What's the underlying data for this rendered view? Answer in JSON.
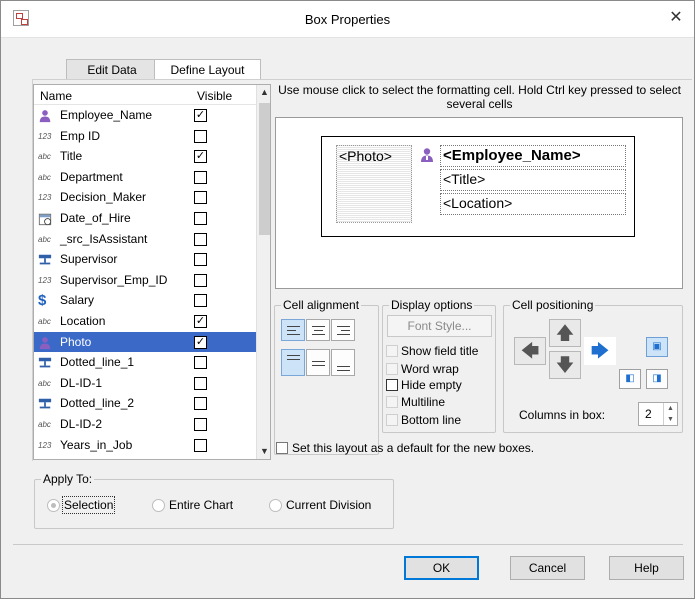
{
  "window": {
    "title": "Box Properties",
    "close_glyph": "✕"
  },
  "tabs": [
    {
      "label": "Edit Data",
      "active": false
    },
    {
      "label": "Define Layout",
      "active": true
    }
  ],
  "field_list": {
    "header_name": "Name",
    "header_visible": "Visible",
    "rows": [
      {
        "name": "Employee_Name",
        "icon": "person-icon",
        "visible": true,
        "selected": false
      },
      {
        "name": "Emp ID",
        "icon": "number-type-icon",
        "visible": false,
        "selected": false
      },
      {
        "name": "Title",
        "icon": "text-type-icon",
        "visible": true,
        "selected": false
      },
      {
        "name": "Department",
        "icon": "text-type-icon",
        "visible": false,
        "selected": false
      },
      {
        "name": "Decision_Maker",
        "icon": "number-type-icon",
        "visible": false,
        "selected": false
      },
      {
        "name": "Date_of_Hire",
        "icon": "calendar-icon",
        "visible": false,
        "selected": false
      },
      {
        "name": "_src_IsAssistant",
        "icon": "text-type-icon",
        "visible": false,
        "selected": false
      },
      {
        "name": "Supervisor",
        "icon": "org-link-icon",
        "visible": false,
        "selected": false
      },
      {
        "name": "Supervisor_Emp_ID",
        "icon": "number-type-icon",
        "visible": false,
        "selected": false
      },
      {
        "name": "Salary",
        "icon": "dollar-icon",
        "visible": false,
        "selected": false
      },
      {
        "name": "Location",
        "icon": "text-type-icon",
        "visible": true,
        "selected": false
      },
      {
        "name": "Photo",
        "icon": "photo-person-icon",
        "visible": true,
        "selected": true
      },
      {
        "name": "Dotted_line_1",
        "icon": "org-link-icon",
        "visible": false,
        "selected": false
      },
      {
        "name": "DL-ID-1",
        "icon": "text-type-icon",
        "visible": false,
        "selected": false
      },
      {
        "name": "Dotted_line_2",
        "icon": "org-link-icon",
        "visible": false,
        "selected": false
      },
      {
        "name": "DL-ID-2",
        "icon": "text-type-icon",
        "visible": false,
        "selected": false
      },
      {
        "name": "Years_in_Job",
        "icon": "number-type-icon",
        "visible": false,
        "selected": false
      }
    ]
  },
  "instruction": "Use mouse click to select the formatting cell. Hold Ctrl key pressed to select several cells",
  "preview": {
    "photo_cell": "<Photo>",
    "name_cell": "<Employee_Name>",
    "title_cell": "<Title>",
    "location_cell": "<Location>"
  },
  "cell_alignment": {
    "title": "Cell alignment"
  },
  "display_options": {
    "title": "Display options",
    "font_style_button": "Font Style...",
    "options": [
      {
        "label": "Show field title",
        "checked": false,
        "enabled": false
      },
      {
        "label": "Word wrap",
        "checked": false,
        "enabled": false
      },
      {
        "label": "Hide empty",
        "checked": false,
        "enabled": true
      },
      {
        "label": "Multiline",
        "checked": false,
        "enabled": false
      },
      {
        "label": "Bottom line",
        "checked": false,
        "enabled": false
      }
    ]
  },
  "cell_positioning": {
    "title": "Cell positioning",
    "columns_label": "Columns in box:",
    "columns_value": "2"
  },
  "default_checkbox": {
    "label": "Set this layout as a default for the new boxes.",
    "checked": false
  },
  "apply_to": {
    "title": "Apply To:",
    "options": [
      {
        "label": "Selection",
        "selected": true
      },
      {
        "label": "Entire Chart",
        "selected": false
      },
      {
        "label": "Current Division",
        "selected": false
      }
    ]
  },
  "buttons": {
    "ok": "OK",
    "cancel": "Cancel",
    "help": "Help"
  },
  "colors": {
    "selection": "#3a69c8",
    "accent": "#1e6fd0",
    "person_icon": "#8b5fbf"
  }
}
